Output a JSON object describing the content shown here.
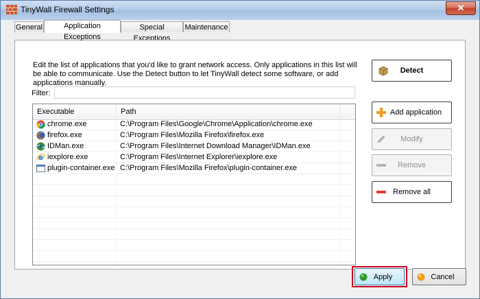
{
  "window": {
    "title": "TinyWall Firewall Settings",
    "close_glyph": "✕"
  },
  "tabs": [
    {
      "label": "General",
      "active": false
    },
    {
      "label": "Application Exceptions",
      "active": true
    },
    {
      "label": "Special Exceptions",
      "active": false
    },
    {
      "label": "Maintenance",
      "active": false
    }
  ],
  "description": "Edit the list of applications that you'd like to grant network access. Only applications in this list will be able to communicate. Use the Detect button to let TinyWall detect some software, or add applications manually.",
  "filter": {
    "label": "Filter:",
    "value": ""
  },
  "listview": {
    "columns": [
      "Executable",
      "Path"
    ],
    "rows": [
      {
        "exe": "chrome.exe",
        "path": "C:\\Program Files\\Google\\Chrome\\Application\\chrome.exe",
        "icon": "chrome-icon"
      },
      {
        "exe": "firefox.exe",
        "path": "C:\\Program Files\\Mozilla Firefox\\firefox.exe",
        "icon": "firefox-icon"
      },
      {
        "exe": "IDMan.exe",
        "path": "C:\\Program Files\\Internet Download Manager\\IDMan.exe",
        "icon": "idm-icon"
      },
      {
        "exe": "iexplore.exe",
        "path": "C:\\Program Files\\Internet Explorer\\iexplore.exe",
        "icon": "ie-icon"
      },
      {
        "exe": "plugin-container.exe",
        "path": "C:\\Program Files\\Mozilla Firefox\\plugin-container.exe",
        "icon": "generic-app-icon"
      }
    ]
  },
  "buttons": {
    "detect": "Detect",
    "add": "Add application",
    "modify": "Modify",
    "remove": "Remove",
    "remove_all": "Remove all",
    "apply": "Apply",
    "cancel": "Cancel"
  },
  "colors": {
    "highlight": "#d0021b",
    "accent_orange": "#f39c1f",
    "remove_red": "#e53b2c",
    "apply_green": "#2e9c2a"
  }
}
